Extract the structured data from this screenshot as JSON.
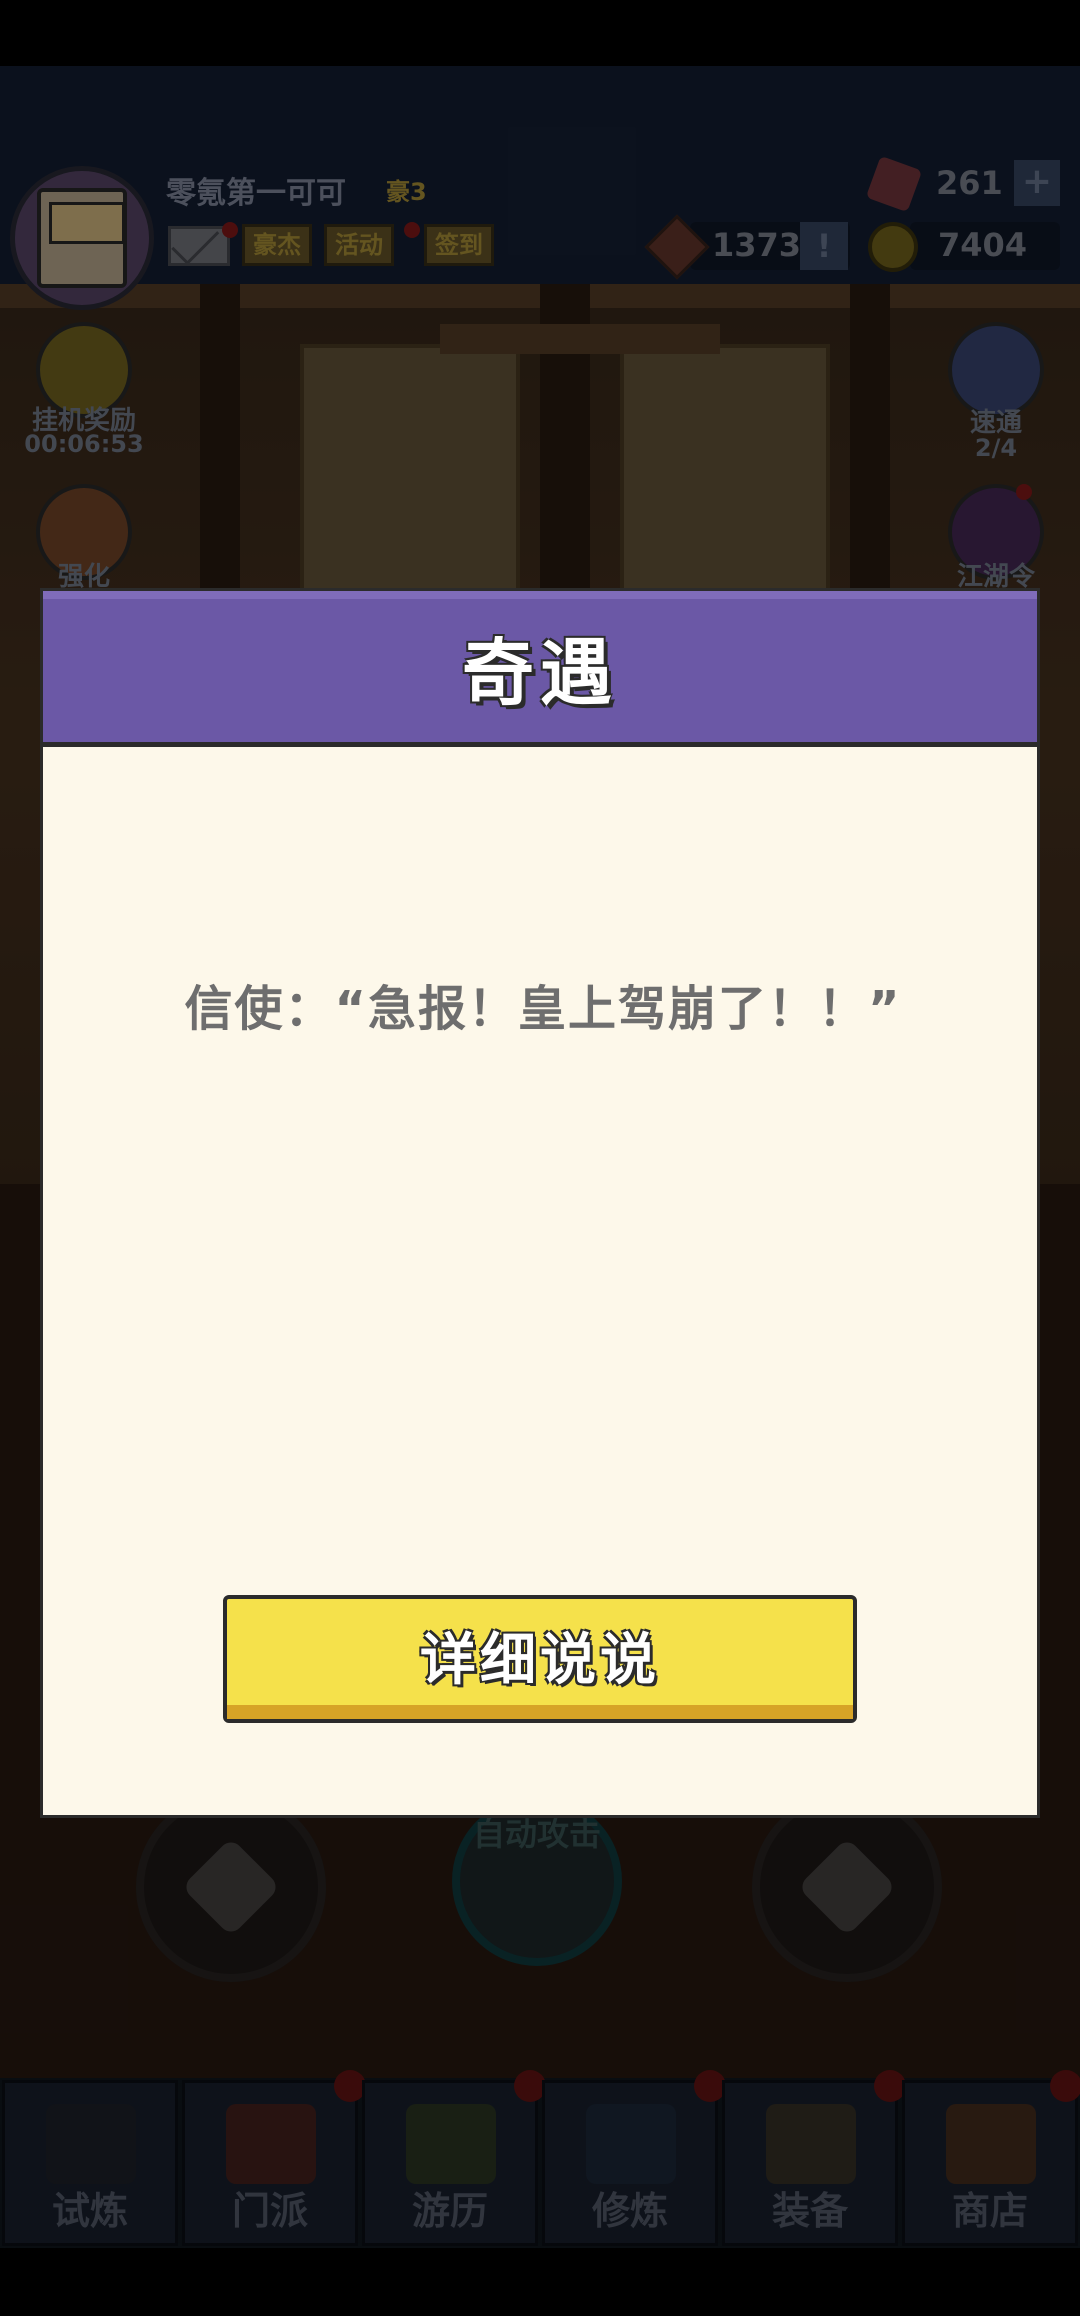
{
  "header": {
    "player_name": "零氪第一可可",
    "vip_label": "豪3",
    "buttons": [
      "豪杰",
      "活动",
      "签到"
    ],
    "gems": "261",
    "tokens": "1373",
    "coins": "7404",
    "plus_glyph": "+",
    "excl_glyph": "!"
  },
  "side_left": {
    "idle_reward_label": "挂机奖励",
    "idle_reward_timer": "00:06:53",
    "enhance_label": "强化"
  },
  "side_right": {
    "quick_label": "速通",
    "quick_count": "2/4",
    "jianghu_label": "江湖令"
  },
  "controls": {
    "auto_attack_label": "自动攻击"
  },
  "bottom_nav": [
    "试炼",
    "门派",
    "游历",
    "修炼",
    "装备",
    "商店"
  ],
  "modal": {
    "title": "奇遇",
    "message": "信使：“急报！皇上驾崩了！！”",
    "button_label": "详细说说"
  },
  "colors": {
    "modal_header": "#6b58a6",
    "modal_body": "#fdf8ea",
    "button_yellow": "#f5e14b",
    "button_shadow": "#d7a326"
  },
  "icons": [
    "mail-icon",
    "gem-icon",
    "token-icon",
    "coin-icon",
    "plus-icon",
    "exclamation-icon",
    "chest-icon",
    "enhance-icon",
    "ninja-icon",
    "emblem-icon"
  ]
}
